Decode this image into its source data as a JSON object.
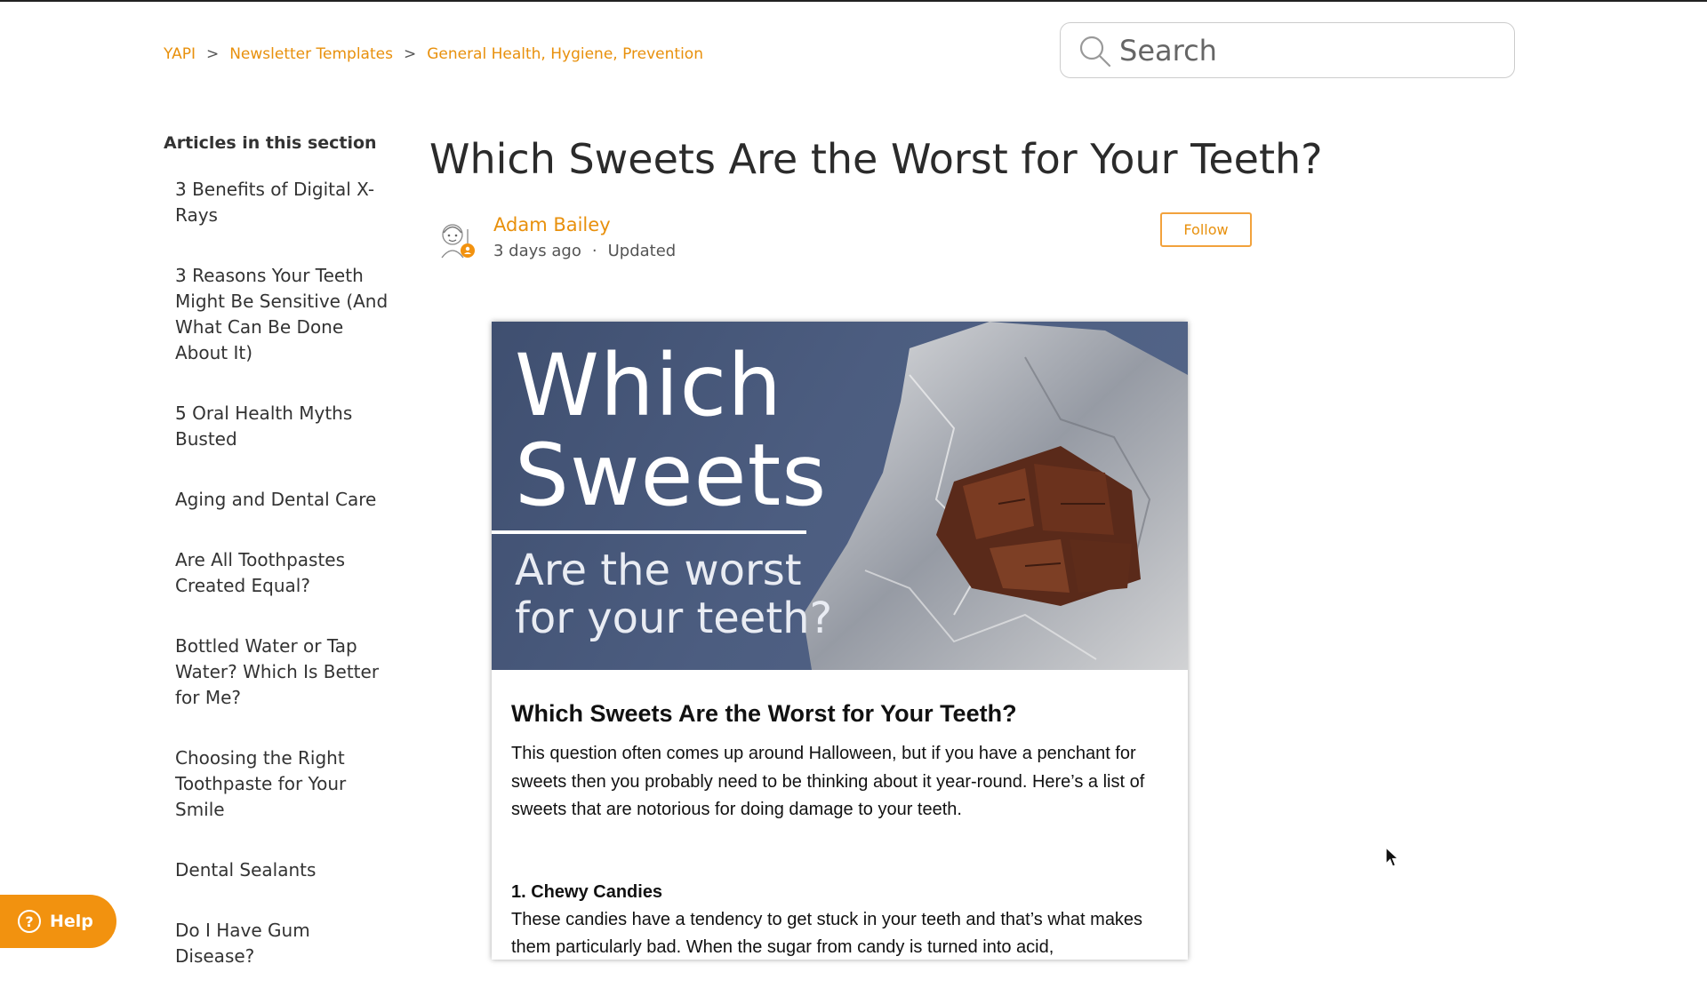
{
  "breadcrumb": {
    "items": [
      "YAPI",
      "Newsletter Templates",
      "General Health, Hygiene, Prevention"
    ],
    "separator": ">"
  },
  "search": {
    "placeholder": "Search",
    "icon": "search-icon"
  },
  "sidebar": {
    "heading": "Articles in this section",
    "items": [
      "3 Benefits of Digital X-Rays",
      "3 Reasons Your Teeth Might Be Sensitive (And What Can Be Done About It)",
      "5 Oral Health Myths Busted",
      "Aging and Dental Care",
      "Are All Toothpastes Created Equal?",
      "Bottled Water or Tap Water? Which Is Better for Me?",
      "Choosing the Right Toothpaste for Your Smile",
      "Dental Sealants",
      "Do I Have Gum Disease?"
    ]
  },
  "article": {
    "title": "Which Sweets Are the Worst for Your Teeth?",
    "author": "Adam Bailey",
    "time_ago": "3 days ago",
    "meta_separator": "·",
    "status": "Updated",
    "follow_label": "Follow"
  },
  "newsletter": {
    "hero_line1": "Which",
    "hero_line2": "Sweets",
    "hero_sub1": "Are the worst",
    "hero_sub2": "for your teeth?",
    "heading": "Which Sweets Are the Worst for Your Teeth?",
    "intro": "This question often comes up around Halloween, but if you have a penchant for sweets then you probably need to be thinking about it year-round. Here’s a list of sweets that are notorious for doing damage to your teeth.",
    "section1_title": "1. Chewy Candies",
    "section1_text": "These candies have a tendency to get stuck in your teeth and that’s what makes them particularly bad. When the sugar from candy is turned into acid,"
  },
  "help": {
    "label": "Help",
    "icon": "question-circle-icon"
  },
  "colors": {
    "accent": "#e8900c",
    "help_bg": "#f2920f",
    "hero_bg": "#4c5d80"
  }
}
